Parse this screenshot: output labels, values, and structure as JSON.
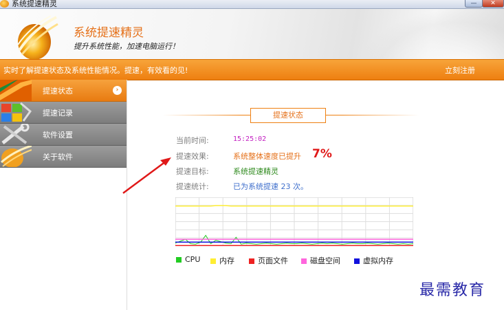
{
  "window": {
    "title": "系统提速精灵",
    "minimize_glyph": "—",
    "close_glyph": "✕"
  },
  "header": {
    "title": "系统提速精灵",
    "subtitle": "提升系统性能，加速电脑运行！"
  },
  "strip": {
    "message": "实时了解提速状态及系统性能情况。提速，有效看的见!",
    "register": "立刻注册"
  },
  "sidebar": {
    "items": [
      {
        "label": "提速状态",
        "active": true
      },
      {
        "label": "提速记录",
        "active": false
      },
      {
        "label": "软件设置",
        "active": false
      },
      {
        "label": "关于软件",
        "active": false
      }
    ],
    "chevron_glyph": "›"
  },
  "panel": {
    "section_title": "提速状态",
    "rows": [
      {
        "label": "当前时间:",
        "value": "15:25:02"
      },
      {
        "label": "提速效果:",
        "value": "系统整体速度已提升",
        "extra": "7%"
      },
      {
        "label": "提速目标:",
        "value": "系统提速精灵"
      },
      {
        "label": "提速统计:",
        "value": "已为系统提速 23 次。"
      }
    ]
  },
  "chart_data": {
    "type": "line",
    "ylim": [
      0,
      100
    ],
    "grid": true,
    "series": [
      {
        "name": "CPU",
        "color": "#22cc22",
        "values": [
          6,
          10,
          14,
          5,
          4,
          8,
          22,
          5,
          12,
          9,
          6,
          5,
          18,
          4,
          6,
          5,
          4,
          5,
          6,
          5,
          4,
          5,
          6,
          5,
          5,
          6,
          5,
          4,
          5,
          6,
          5,
          6,
          5,
          4,
          5,
          6,
          5,
          5,
          6,
          5,
          4,
          5,
          6,
          5,
          4,
          5,
          4,
          5
        ]
      },
      {
        "name": "内存",
        "color": "#ffee33",
        "values": [
          82,
          82,
          82,
          82,
          82,
          82,
          82,
          82,
          83,
          83,
          83,
          82,
          82,
          82,
          82,
          82,
          82,
          82,
          82,
          82,
          82,
          82,
          82,
          82,
          82,
          82,
          82,
          82,
          82,
          82,
          82,
          82,
          82,
          82,
          82,
          82,
          82,
          82,
          82,
          82,
          82,
          82,
          82,
          82,
          82,
          82,
          82,
          82
        ]
      },
      {
        "name": "页面文件",
        "color": "#ee2222",
        "values": [
          1,
          1,
          1,
          1,
          1,
          1,
          1,
          1,
          1,
          1,
          1,
          1,
          1,
          1,
          1,
          1,
          1,
          1,
          1,
          1,
          1,
          1,
          1,
          1,
          1,
          1,
          1,
          1,
          1,
          1,
          1,
          1,
          1,
          1,
          1,
          1,
          1,
          1,
          1,
          1,
          1,
          1,
          1,
          1,
          1,
          1,
          1,
          1
        ]
      },
      {
        "name": "磁盘空间",
        "color": "#ff66dd",
        "values": [
          14,
          14,
          14,
          14,
          14,
          14,
          14,
          14,
          14,
          14,
          14,
          14,
          14,
          14,
          14,
          14,
          14,
          14,
          14,
          14,
          14,
          14,
          14,
          14,
          14,
          14,
          14,
          14,
          14,
          14,
          14,
          14,
          14,
          14,
          14,
          14,
          14,
          14,
          14,
          14,
          14,
          14,
          14,
          14,
          14,
          14,
          14,
          14
        ]
      },
      {
        "name": "虚拟内存",
        "color": "#1111dd",
        "values": [
          8,
          8,
          8,
          8,
          8,
          8,
          8,
          8,
          8,
          8,
          8,
          8,
          8,
          8,
          8,
          8,
          8,
          8,
          8,
          8,
          8,
          8,
          8,
          8,
          8,
          8,
          8,
          8,
          8,
          8,
          8,
          8,
          8,
          8,
          8,
          8,
          8,
          8,
          8,
          8,
          8,
          8,
          8,
          8,
          8,
          8,
          8,
          8
        ]
      }
    ]
  },
  "watermark": "最需教育",
  "colors": {
    "accent": "#ee7f10",
    "nav_inactive": "#8a8a8a"
  }
}
